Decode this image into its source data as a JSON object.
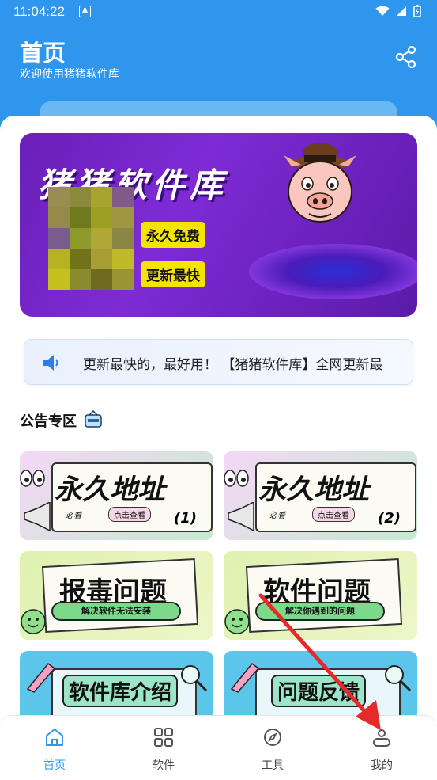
{
  "status_bar": {
    "time": "11:04:22",
    "a_badge": "A"
  },
  "header": {
    "title": "首页",
    "subtitle": "欢迎使用猪猪软件库",
    "share_icon": "share-icon"
  },
  "banner": {
    "title": "猪猪软件库",
    "tag1": "永久免费",
    "tag2": "更新最快"
  },
  "notice": {
    "icon": "speaker-icon",
    "text": "更新最快的，最好用！ 【猪猪软件库】全网更新最"
  },
  "section": {
    "title": "公告专区"
  },
  "tiles": [
    {
      "big": "永久地址",
      "small_left": "必看",
      "small_right": "点击查看",
      "num": "(1)"
    },
    {
      "big": "永久地址",
      "small_left": "必看",
      "small_right": "点击查看",
      "num": "(2)"
    },
    {
      "big": "报毒问题",
      "pill": "解决软件无法安装"
    },
    {
      "big": "软件问题",
      "pill": "解决你遇到的问题"
    },
    {
      "big": "软件库介绍"
    },
    {
      "big": "问题反馈"
    }
  ],
  "nav": [
    {
      "label": "首页",
      "icon": "home-icon",
      "active": true
    },
    {
      "label": "软件",
      "icon": "grid-icon",
      "active": false
    },
    {
      "label": "工具",
      "icon": "compass-icon",
      "active": false
    },
    {
      "label": "我的",
      "icon": "user-icon",
      "active": false
    }
  ],
  "colors": {
    "primary": "#2f96ee",
    "banner": "#7e2bd6",
    "tag": "#f4e400",
    "arrow": "#e62a2a"
  }
}
